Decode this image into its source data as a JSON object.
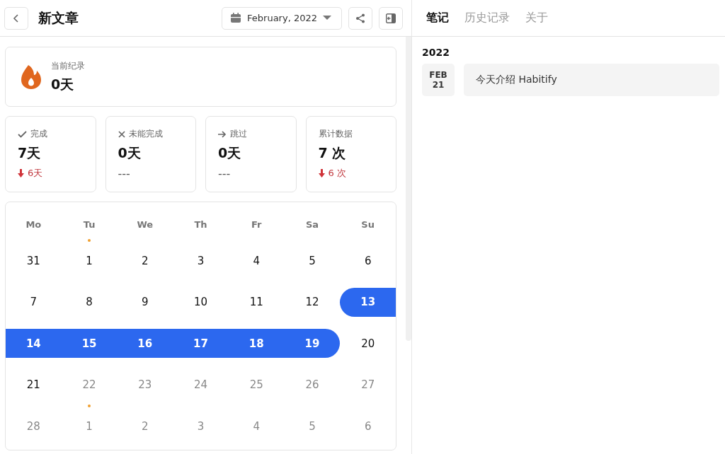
{
  "header": {
    "title": "新文章",
    "month": "February, 2022"
  },
  "streak": {
    "label": "当前纪录",
    "value": "0天"
  },
  "stats": [
    {
      "kind": "check",
      "label": "完成",
      "value": "7天",
      "down": true,
      "change": "6天"
    },
    {
      "kind": "cross",
      "label": "未能完成",
      "value": "0天",
      "down": false,
      "change": "---"
    },
    {
      "kind": "arrow",
      "label": "跳过",
      "value": "0天",
      "down": false,
      "change": "---"
    },
    {
      "kind": "none",
      "label": "累计数据",
      "value": "7 次",
      "down": true,
      "change": "6 次"
    }
  ],
  "calendar": {
    "weekdays": [
      "Mo",
      "Tu",
      "We",
      "Th",
      "Fr",
      "Sa",
      "Su"
    ],
    "days": [
      {
        "day": "31",
        "done": false,
        "future": false,
        "dot": false
      },
      {
        "day": "1",
        "done": false,
        "future": false,
        "dot": true
      },
      {
        "day": "2",
        "done": false,
        "future": false,
        "dot": false
      },
      {
        "day": "3",
        "done": false,
        "future": false,
        "dot": false
      },
      {
        "day": "4",
        "done": false,
        "future": false,
        "dot": false
      },
      {
        "day": "5",
        "done": false,
        "future": false,
        "dot": false
      },
      {
        "day": "6",
        "done": false,
        "future": false,
        "dot": false
      },
      {
        "day": "7",
        "done": false,
        "future": false,
        "dot": false
      },
      {
        "day": "8",
        "done": false,
        "future": false,
        "dot": false
      },
      {
        "day": "9",
        "done": false,
        "future": false,
        "dot": false
      },
      {
        "day": "10",
        "done": false,
        "future": false,
        "dot": false
      },
      {
        "day": "11",
        "done": false,
        "future": false,
        "dot": false
      },
      {
        "day": "12",
        "done": false,
        "future": false,
        "dot": false
      },
      {
        "day": "13",
        "done": true,
        "future": false,
        "dot": false
      },
      {
        "day": "14",
        "done": true,
        "future": false,
        "dot": false
      },
      {
        "day": "15",
        "done": true,
        "future": false,
        "dot": false
      },
      {
        "day": "16",
        "done": true,
        "future": false,
        "dot": false
      },
      {
        "day": "17",
        "done": true,
        "future": false,
        "dot": false
      },
      {
        "day": "18",
        "done": true,
        "future": false,
        "dot": false
      },
      {
        "day": "19",
        "done": true,
        "future": false,
        "dot": false
      },
      {
        "day": "20",
        "done": false,
        "future": false,
        "dot": false
      },
      {
        "day": "21",
        "done": false,
        "future": false,
        "dot": false
      },
      {
        "day": "22",
        "done": false,
        "future": true,
        "dot": false
      },
      {
        "day": "23",
        "done": false,
        "future": true,
        "dot": false
      },
      {
        "day": "24",
        "done": false,
        "future": true,
        "dot": false
      },
      {
        "day": "25",
        "done": false,
        "future": true,
        "dot": false
      },
      {
        "day": "26",
        "done": false,
        "future": true,
        "dot": false
      },
      {
        "day": "27",
        "done": false,
        "future": true,
        "dot": false
      },
      {
        "day": "28",
        "done": false,
        "future": true,
        "dot": false
      },
      {
        "day": "1",
        "done": false,
        "future": true,
        "dot": true
      },
      {
        "day": "2",
        "done": false,
        "future": true,
        "dot": false
      },
      {
        "day": "3",
        "done": false,
        "future": true,
        "dot": false
      },
      {
        "day": "4",
        "done": false,
        "future": true,
        "dot": false
      },
      {
        "day": "5",
        "done": false,
        "future": true,
        "dot": false
      },
      {
        "day": "6",
        "done": false,
        "future": true,
        "dot": false
      }
    ]
  },
  "tabs": [
    {
      "label": "笔记",
      "selected": true
    },
    {
      "label": "历史记录",
      "selected": false
    },
    {
      "label": "关于",
      "selected": false
    }
  ],
  "notes": {
    "year": "2022",
    "entries": [
      {
        "month": "FEB",
        "day": "21",
        "text": "今天介绍 Habitify"
      }
    ]
  }
}
